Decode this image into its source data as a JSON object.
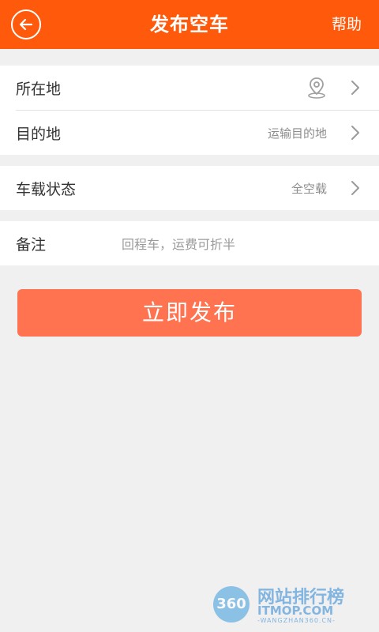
{
  "header": {
    "title": "发布空车",
    "help_label": "帮助",
    "background_color": "#ff5a0c"
  },
  "form": {
    "location": {
      "label": "所在地",
      "icon": "location-pin-icon"
    },
    "destination": {
      "label": "目的地",
      "value": "运输目的地"
    },
    "load_status": {
      "label": "车载状态",
      "value": "全空载"
    },
    "remark": {
      "label": "备注",
      "placeholder": "回程车，运费可折半"
    }
  },
  "publish_button": {
    "label": "立即发布",
    "color": "#ff7350"
  },
  "watermark": {
    "badge": "360",
    "title": "网站排行榜",
    "subtitle": "ITMOP.COM",
    "url": "-WANGZHAN360.CN-"
  }
}
